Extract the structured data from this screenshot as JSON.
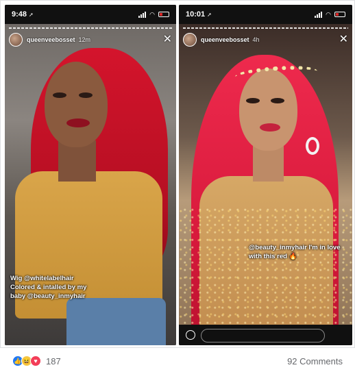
{
  "stories": [
    {
      "status_time": "9:48",
      "username": "queenveebosset",
      "posted": "12m",
      "caption": "Wig @whitelabelhair Colored & intalled by my baby @beauty_inmyhair"
    },
    {
      "status_time": "10:01",
      "username": "queenveebosset",
      "posted": "4h",
      "caption": "@beauty_inmyhair I'm in love with this red 🔥"
    }
  ],
  "icons": {
    "location": "➚",
    "wifi": "◠",
    "close": "✕",
    "like": "👍",
    "haha": "😆",
    "love": "♥"
  },
  "footer": {
    "reaction_count": "187",
    "comments": "92 Comments"
  }
}
